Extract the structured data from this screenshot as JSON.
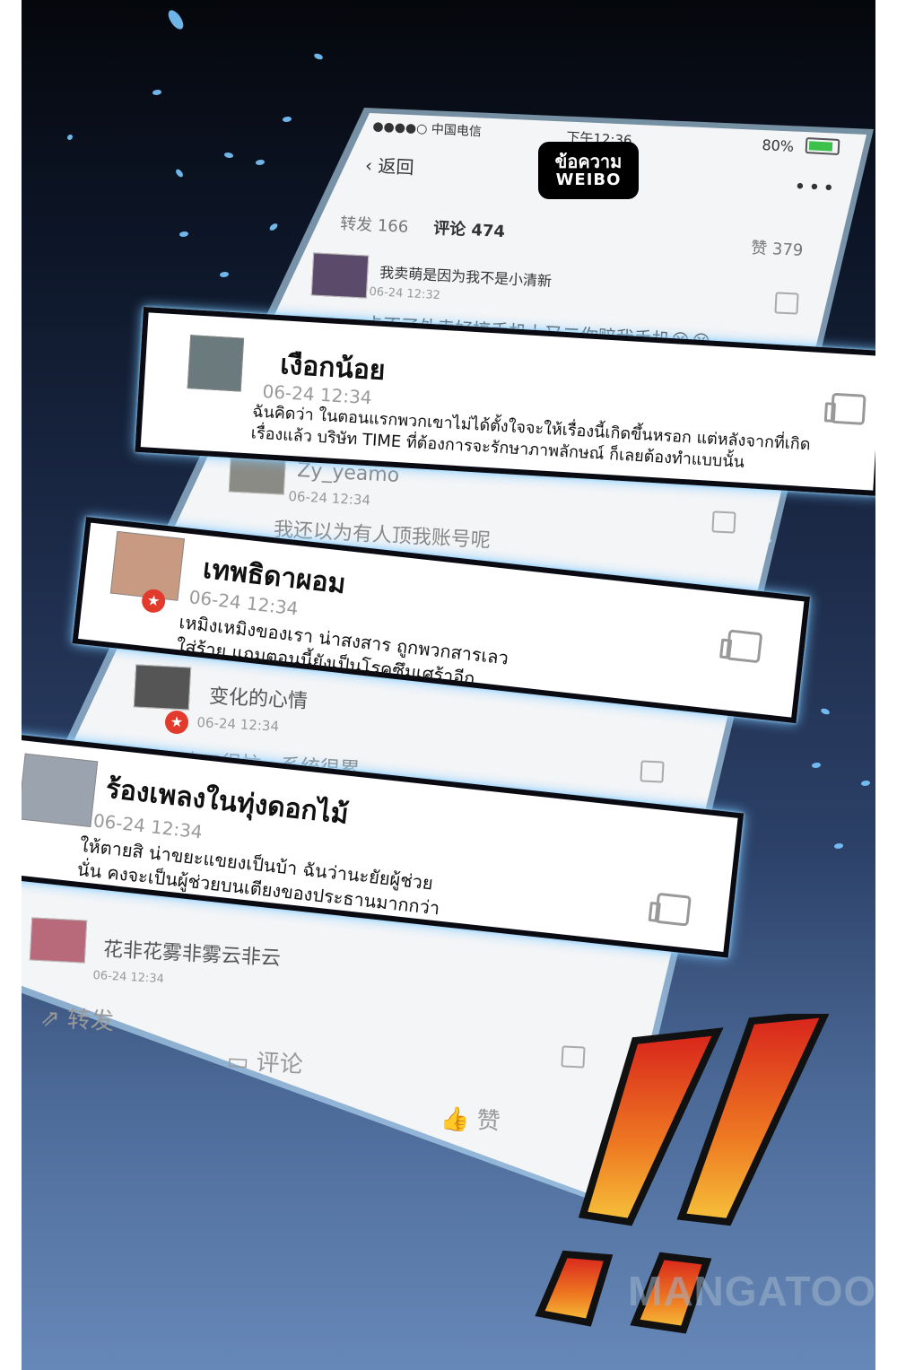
{
  "phone": {
    "status_left": "●●●●○ 中国电信",
    "status_time": "下午12:36",
    "status_battery": "80%",
    "back_label": "返回",
    "title_line1": "ข้อความ",
    "title_line2": "WEIBO",
    "more_icon": "more-dots-icon",
    "tab_repost": "转发 166",
    "tab_comment": "评论 474",
    "tab_like": "赞 379",
    "comments": [
      {
        "text": "我卖萌是因为我不是小清新",
        "time": "06-24 12:32"
      },
      {
        "text": "卡不了外卖好搞手机上又二你赔我手机😭😭"
      },
      {
        "name": "Zy_yeamo",
        "time": "06-24 12:34",
        "text": "我还以为有人顶我账号呢"
      },
      {
        "name": "变化的心情",
        "time": "06-24 12:34",
        "text": "小二很忙，系统很累"
      },
      {
        "name": "花非花雾非雾云非云",
        "time": "06-24 12:34"
      }
    ],
    "bottom_repost": "转发",
    "bottom_comment": "评论",
    "bottom_like": "赞"
  },
  "cards": [
    {
      "name": "เงือกน้อย",
      "time": "06-24 12:34",
      "line1": "ฉันคิดว่า ในตอนแรกพวกเขาไม่ได้ตั้งใจจะให้เรื่องนี้เกิดขึ้นหรอก แต่หลังจากที่เกิด",
      "line2": "เรื่องแล้ว บริษัท TIME ที่ต้องการจะรักษาภาพลักษณ์ ก็เลยต้องทำแบบนั้น"
    },
    {
      "name": "เทพธิดาผอม",
      "time": "06-24 12:34",
      "line1": "เหมิงเหมิงของเรา น่าสงสาร ถูกพวกสารเลว",
      "line2": "ใส่ร้าย แถมตอนนี้ยังเป็นโรคซึมเศร้าอีก"
    },
    {
      "name": "ร้องเพลงในทุ่งดอกไม้",
      "time": "06-24 12:34",
      "line1": "ให้ตายสิ น่าขยะแขยงเป็นบ้า ฉันว่านะยัยผู้ช่วย",
      "line2": "นั่น คงจะเป็นผู้ช่วยบนเตียงของประธานมากกว่า"
    }
  ],
  "watermark": "MANGATOON",
  "colors": {
    "glow": "#7cc8ff",
    "exclaim_top": "#d8231c",
    "exclaim_bottom": "#f6c23a"
  }
}
